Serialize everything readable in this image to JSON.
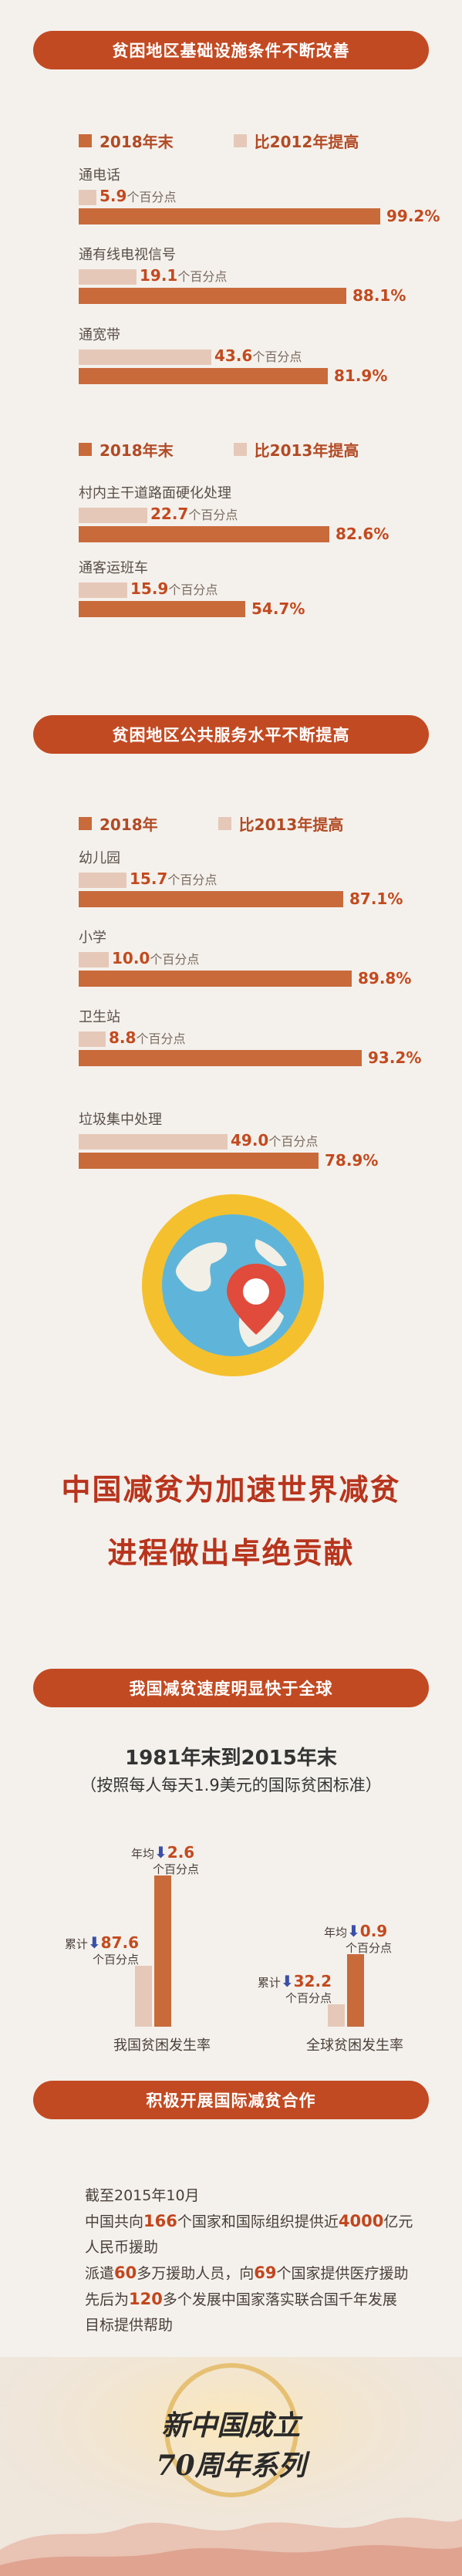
{
  "section1": {
    "title": "贫困地区基础设施条件不断改善",
    "legend_a": {
      "dark": "2018年末",
      "light": "比2012年提高"
    },
    "legend_b": {
      "dark": "2018年末",
      "light": "比2013年提高"
    },
    "items": [
      {
        "name": "通电话",
        "increase": "5.9",
        "value": "99.2%"
      },
      {
        "name": "通有线电视信号",
        "increase": "19.1",
        "value": "88.1%"
      },
      {
        "name": "通宽带",
        "increase": "43.6",
        "value": "81.9%"
      },
      {
        "name": "村内主干道路面硬化处理",
        "increase": "22.7",
        "value": "82.6%"
      },
      {
        "name": "通客运班车",
        "increase": "15.9",
        "value": "54.7%"
      }
    ],
    "unit": "个百分点"
  },
  "section2": {
    "title": "贫困地区公共服务水平不断提高",
    "legend": {
      "dark": "2018年",
      "light": "比2013年提高"
    },
    "items": [
      {
        "name": "幼儿园",
        "increase": "15.7",
        "value": "87.1%"
      },
      {
        "name": "小学",
        "increase": "10.0",
        "value": "89.8%"
      },
      {
        "name": "卫生站",
        "increase": "8.8",
        "value": "93.2%"
      },
      {
        "name": "垃圾集中处理",
        "increase": "49.0",
        "value": "78.9%"
      }
    ],
    "unit": "个百分点"
  },
  "headline": {
    "line1": "中国减贫为加速世界减贫",
    "line2": "进程做出卓绝贡献"
  },
  "section3": {
    "title": "我国减贫速度明显快于全球",
    "subtitle1": "1981年末到2015年末",
    "subtitle2": "（按照每人每天1.9美元的国际贫困标准）",
    "groups": [
      {
        "label": "我国贫困发生率",
        "cum_label": "累计",
        "cum": "87.6",
        "avg_label": "年均",
        "avg": "2.6"
      },
      {
        "label": "全球贫困发生率",
        "cum_label": "累计",
        "cum": "32.2",
        "avg_label": "年均",
        "avg": "0.9"
      }
    ],
    "unit": "个百分点"
  },
  "section4": {
    "title": "积极开展国际减贫合作",
    "date": "截至2015年10月",
    "line1_a": "中国共向",
    "line1_n1": "166",
    "line1_b": "个国家和国际组织提供近",
    "line1_n2": "4000",
    "line1_c": "亿元",
    "line2": "人民币援助",
    "line3_a": "派遣",
    "line3_n1": "60",
    "line3_b": "多万援助人员，向",
    "line3_n2": "69",
    "line3_c": "个国家提供医疗援助",
    "line4_a": "先后为",
    "line4_n1": "120",
    "line4_b": "多个发展中国家落实联合国千年发展",
    "line5": "目标提供帮助"
  },
  "footer": {
    "line1": "新中国成立",
    "line2": "70周年系列"
  },
  "colors": {
    "accent": "#c24a22",
    "bar_dark": "#c96a3b",
    "bar_light": "#e6c8b9",
    "arrow": "#3a4fa8"
  },
  "chart_data": [
    {
      "type": "bar",
      "title": "贫困地区基础设施条件不断改善",
      "categories": [
        "通电话",
        "通有线电视信号",
        "通宽带",
        "村内主干道路面硬化处理",
        "通客运班车"
      ],
      "series": [
        {
          "name": "2018年末",
          "values": [
            99.2,
            88.1,
            81.9,
            82.6,
            54.7
          ]
        },
        {
          "name": "比2012年提高 / 比2013年提高",
          "values": [
            5.9,
            19.1,
            43.6,
            22.7,
            15.9
          ]
        }
      ]
    },
    {
      "type": "bar",
      "title": "贫困地区公共服务水平不断提高",
      "categories": [
        "幼儿园",
        "小学",
        "卫生站",
        "垃圾集中处理"
      ],
      "series": [
        {
          "name": "2018年",
          "values": [
            87.1,
            89.8,
            93.2,
            78.9
          ]
        },
        {
          "name": "比2013年提高",
          "values": [
            15.7,
            10.0,
            8.8,
            49.0
          ]
        }
      ]
    },
    {
      "type": "bar",
      "title": "我国减贫速度明显快于全球",
      "categories": [
        "我国贫困发生率",
        "全球贫困发生率"
      ],
      "series": [
        {
          "name": "累计",
          "values": [
            87.6,
            32.2
          ]
        },
        {
          "name": "年均",
          "values": [
            2.6,
            0.9
          ]
        }
      ]
    }
  ]
}
